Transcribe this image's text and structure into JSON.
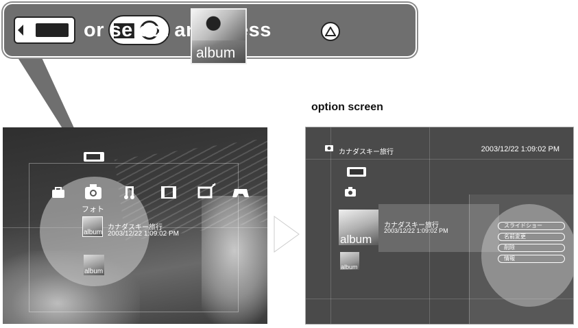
{
  "callout": {
    "instruction_text": "or select and press",
    "album_label": "album"
  },
  "left_screen": {
    "category_label": "フォト",
    "items": [
      {
        "thumb_label": "album",
        "title": "カナダスキー旅行",
        "date": "2003/12/22 1:09:02 PM"
      },
      {
        "thumb_label": "album"
      }
    ],
    "icons": [
      "memory-stick-icon",
      "settings-icon",
      "photo-icon",
      "music-icon",
      "video-icon",
      "network-icon",
      "game-icon"
    ]
  },
  "right_screen": {
    "heading": "option screen",
    "header_title": "カナダスキー旅行",
    "header_date": "2003/12/22 1:09:02 PM",
    "selected_item": {
      "thumb_label": "album",
      "title": "カナダスキー旅行",
      "date": "2003/12/22 1:09:02 PM"
    },
    "second_item": {
      "thumb_label": "album"
    },
    "options": [
      "スライドショー",
      "名前変更",
      "削除",
      "情報"
    ]
  },
  "colors": {
    "callout_bg": "#6f6f6f",
    "screen_bg": "#4a4a4a",
    "highlight": "#cccccc"
  }
}
